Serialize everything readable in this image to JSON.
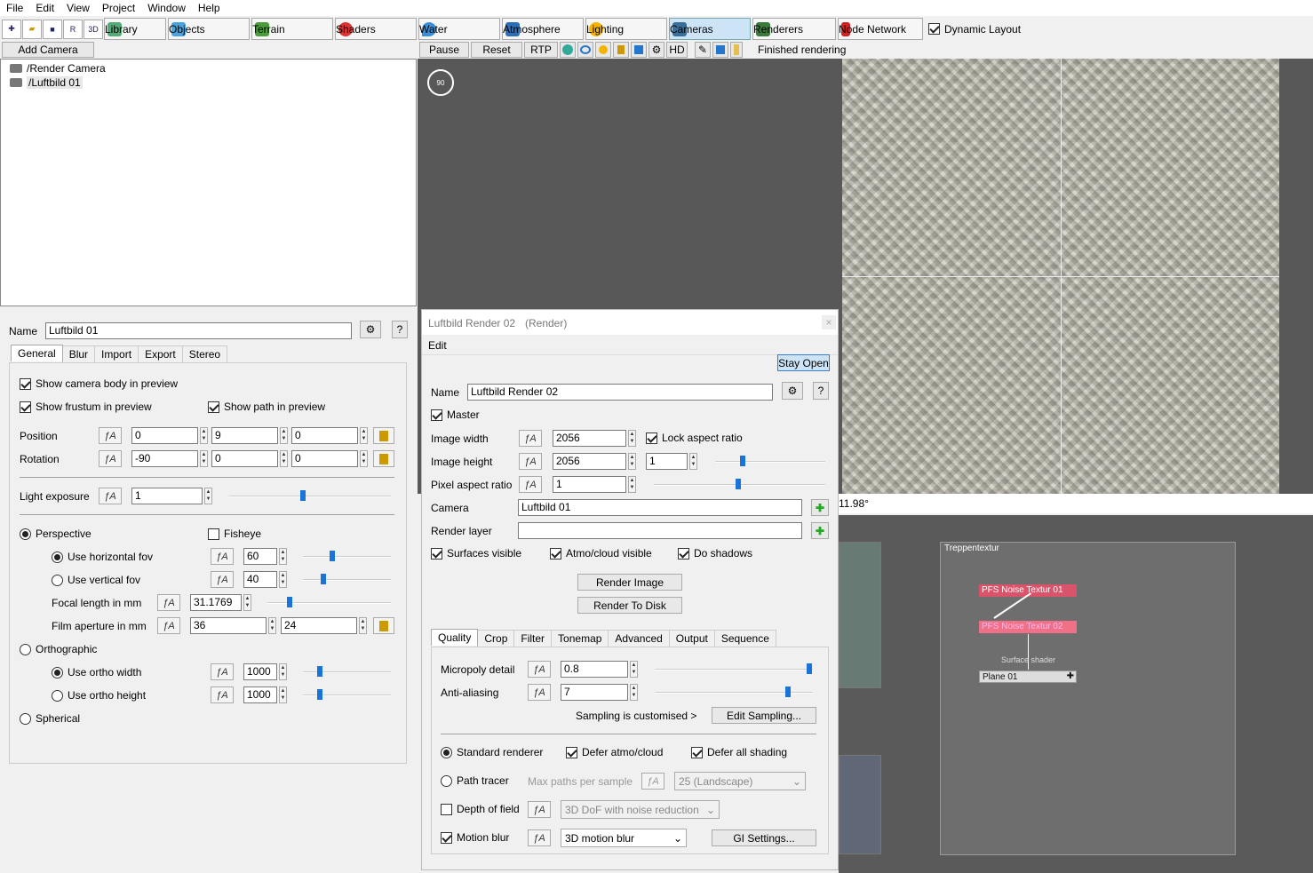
{
  "menu": [
    "File",
    "Edit",
    "View",
    "Project",
    "Window",
    "Help"
  ],
  "toolbar": {
    "tabs": [
      {
        "label": "Library",
        "icon": "books-icon",
        "color": "#5a7"
      },
      {
        "label": "Objects",
        "icon": "cube-icon",
        "color": "#4aa3df"
      },
      {
        "label": "Terrain",
        "icon": "terrain-icon",
        "color": "#4a9d3a"
      },
      {
        "label": "Shaders",
        "icon": "sphere-icon",
        "color": "#d33"
      },
      {
        "label": "Water",
        "icon": "water-drop-icon",
        "color": "#3a8fd8"
      },
      {
        "label": "Atmosphere",
        "icon": "sky-icon",
        "color": "#2c6fb8"
      },
      {
        "label": "Lighting",
        "icon": "sun-icon",
        "color": "#f5b400"
      },
      {
        "label": "Cameras",
        "icon": "camera-icon",
        "color": "#3a6f9a",
        "active": true
      },
      {
        "label": "Renderers",
        "icon": "landscape-icon",
        "color": "#3a7a3a"
      },
      {
        "label": "Node Network",
        "icon": "node-network-icon",
        "color": "#c22"
      }
    ],
    "dynamic_layout": "Dynamic Layout"
  },
  "left": {
    "add_camera": "Add Camera",
    "tree": [
      "/Render Camera",
      "/Luftbild 01"
    ],
    "name_label": "Name",
    "name_value": "Luftbild 01",
    "tabs": [
      "General",
      "Blur",
      "Import",
      "Export",
      "Stereo"
    ],
    "show_body": "Show camera body in preview",
    "show_frustum": "Show frustum in preview",
    "show_path": "Show path in preview",
    "position_label": "Position",
    "position": [
      "0",
      "9",
      "0"
    ],
    "rotation_label": "Rotation",
    "rotation": [
      "-90",
      "0",
      "0"
    ],
    "light_exposure_label": "Light exposure",
    "light_exposure": "1",
    "perspective": "Perspective",
    "fisheye": "Fisheye",
    "use_hfov": "Use horizontal fov",
    "hfov": "60",
    "use_vfov": "Use vertical fov",
    "vfov": "40",
    "focal_label": "Focal length in mm",
    "focal": "31.1769",
    "aperture_label": "Film aperture in mm",
    "aperture": [
      "36",
      "24"
    ],
    "orthographic": "Orthographic",
    "ortho_width": "Use ortho width",
    "ortho_width_val": "1000",
    "ortho_height": "Use ortho height",
    "ortho_height_val": "1000",
    "spherical": "Spherical"
  },
  "render_bar": {
    "pause": "Pause",
    "reset": "Reset",
    "rtp": "RTP",
    "hd": "HD",
    "status": "Finished rendering"
  },
  "viewport": {
    "readout": "11.98°",
    "compass": "90"
  },
  "dialog": {
    "title": "Luftbild Render 02",
    "subtitle": "(Render)",
    "menu": "Edit",
    "stay_open": "Stay Open",
    "name_label": "Name",
    "name_value": "Luftbild Render 02",
    "master": "Master",
    "width_label": "Image width",
    "width": "2056",
    "lock_aspect": "Lock aspect ratio",
    "height_label": "Image height",
    "height": "2056",
    "ratio": "1",
    "pixel_label": "Pixel aspect ratio",
    "pixel": "1",
    "camera_label": "Camera",
    "camera": "Luftbild 01",
    "layer_label": "Render layer",
    "layer": "",
    "surfaces": "Surfaces visible",
    "atmo": "Atmo/cloud visible",
    "shadows": "Do shadows",
    "render_image": "Render Image",
    "render_disk": "Render To Disk",
    "tabs": [
      "Quality",
      "Crop",
      "Filter",
      "Tonemap",
      "Advanced",
      "Output",
      "Sequence"
    ],
    "micropoly_label": "Micropoly detail",
    "micropoly": "0.8",
    "aa_label": "Anti-aliasing",
    "aa": "7",
    "sampling": "Sampling is customised  >",
    "edit_sampling": "Edit Sampling...",
    "standard": "Standard renderer",
    "defer_atmo": "Defer atmo/cloud",
    "defer_all": "Defer all shading",
    "path_tracer": "Path tracer",
    "max_paths": "Max paths per sample",
    "paths_sel": "25 (Landscape)",
    "dof": "Depth of field",
    "dof_sel": "3D DoF with noise reduction",
    "motion": "Motion blur",
    "motion_sel": "3D motion blur",
    "gi": "GI Settings..."
  },
  "nodes": {
    "group": "Treppentextur",
    "n1": "PFS Noise Textur 01",
    "n2": "PFS Noise Textur 02",
    "surface": "Surface shader",
    "plane": "Plane 01"
  }
}
